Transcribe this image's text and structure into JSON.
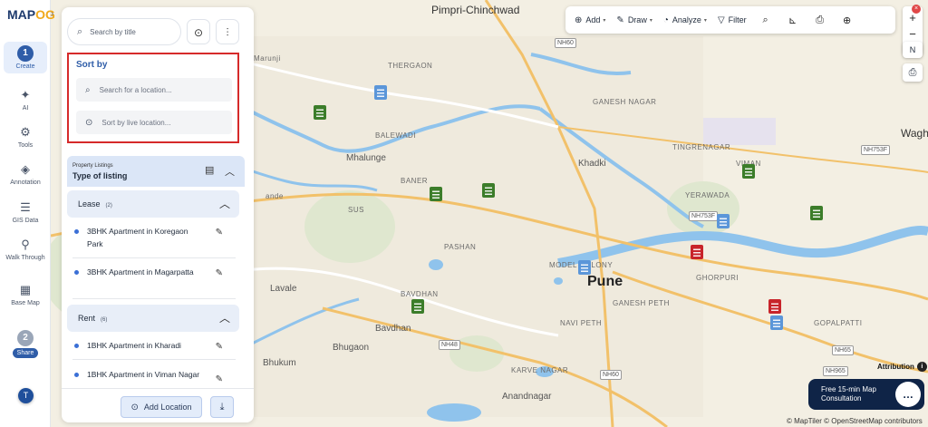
{
  "app": {
    "logo_main": "MAP",
    "logo_accent": "OG",
    "collapse_glyph": "›"
  },
  "rail": {
    "items": [
      {
        "label": "Create",
        "step": "1"
      },
      {
        "label": "AI"
      },
      {
        "label": "Tools"
      },
      {
        "label": "Annotation"
      },
      {
        "label": "GIS Data"
      },
      {
        "label": "Walk Through"
      },
      {
        "label": "Base Map"
      }
    ],
    "share": {
      "step": "2",
      "label": "Share"
    },
    "avatar": "T"
  },
  "panel": {
    "search_placeholder": "Search by title",
    "sort": {
      "title": "Sort by",
      "location_placeholder": "Search for a location...",
      "live_placeholder": "Sort by live location..."
    },
    "listings": {
      "small_label": "Property Listings",
      "title": "Type of listing"
    },
    "groups": [
      {
        "label": "Lease",
        "count": "(2)",
        "items": [
          "3BHK Apartment in Koregaon Park",
          "3BHK Apartment in Magarpatta"
        ]
      },
      {
        "label": "Rent",
        "count": "(6)",
        "items": [
          "1BHK Apartment in Kharadi",
          "1BHK Apartment in Viman Nagar"
        ]
      }
    ],
    "footer": {
      "add_location": "Add Location"
    }
  },
  "toolbar": {
    "add": "Add",
    "draw": "Draw",
    "analyze": "Analyze",
    "filter": "Filter"
  },
  "zoom": {
    "in": "+",
    "out": "−",
    "north": "N",
    "close": "×"
  },
  "map": {
    "labels": {
      "pimpri": "Pimpri-Chinchwad",
      "pune": "Pune",
      "khadki": "Khadki",
      "anandnagar": "Anandnagar",
      "bavdhan": "Bavdhan",
      "bhugaon": "Bhugaon",
      "bhukum": "Bhukum",
      "lavale": "Lavale",
      "mhalunge": "Mhalunge",
      "wagho": "Wagho",
      "marunji": "Marunji",
      "thergaon": "THERGAON",
      "balewadi": "BALEWADI",
      "sus": "SUS",
      "baner": "BANER",
      "pashan": "PASHAN",
      "bavdhan_caps": "BAVDHAN",
      "model_colony": "MODEL COLONY",
      "ganesh_peth": "GANESH PETH",
      "navi_peth": "NAVI PETH",
      "karve_nagar": "KARVE NAGAR",
      "yerawada": "YERAWADA",
      "tingrenagar": "TINGRENAGAR",
      "viman": "VIMAN",
      "ghorpuri": "GHORPURI",
      "gopalpatti": "GOPALPATTI",
      "ganesh_nagar": "GANESH NAGAR",
      "hinjewadi": "ande"
    },
    "roads": [
      "NH60",
      "NH753F",
      "NH753F",
      "NH48",
      "NH60",
      "NH65",
      "NH965"
    ],
    "attribution": "Attribution",
    "consult": {
      "line1": "Free 15-min Map",
      "line2": "Consultation"
    },
    "copyright": "© MapTiler © OpenStreetMap contributors"
  }
}
